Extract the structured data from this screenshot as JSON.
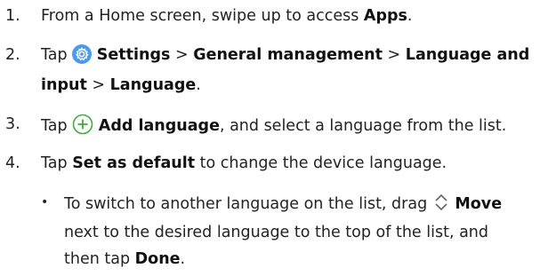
{
  "steps": [
    {
      "number": "1.",
      "prefix": "From a Home screen, swipe up to access ",
      "bold": "Apps",
      "suffix": "."
    },
    {
      "number": "2.",
      "prefix": "Tap",
      "settings": "Settings",
      "sep1": ">",
      "general": "General management",
      "sep2": ">",
      "lang_input_a": "Language and",
      "lang_input_b": "input",
      "sep3": ">",
      "language": "Language",
      "suffix": "."
    },
    {
      "number": "3.",
      "prefix": "Tap",
      "bold": "Add language",
      "suffix": ", and select a language from the list."
    },
    {
      "number": "4.",
      "prefix": "Tap ",
      "bold": "Set as default",
      "suffix": " to change the device language."
    }
  ],
  "sub_bullet": {
    "marker": "•",
    "line1_prefix": "To switch to another language on the list, drag",
    "move": "Move",
    "line2": "next to the desired language to the top of the list, and",
    "line3_prefix": "then tap ",
    "done": "Done",
    "line3_suffix": "."
  },
  "icons": {
    "settings": "settings-gear-icon",
    "add": "add-plus-icon",
    "move": "move-reorder-icon"
  },
  "colors": {
    "settings_icon_bg": "#4a9bf0",
    "add_icon": "#3dab3d",
    "move_icon": "#666666"
  }
}
